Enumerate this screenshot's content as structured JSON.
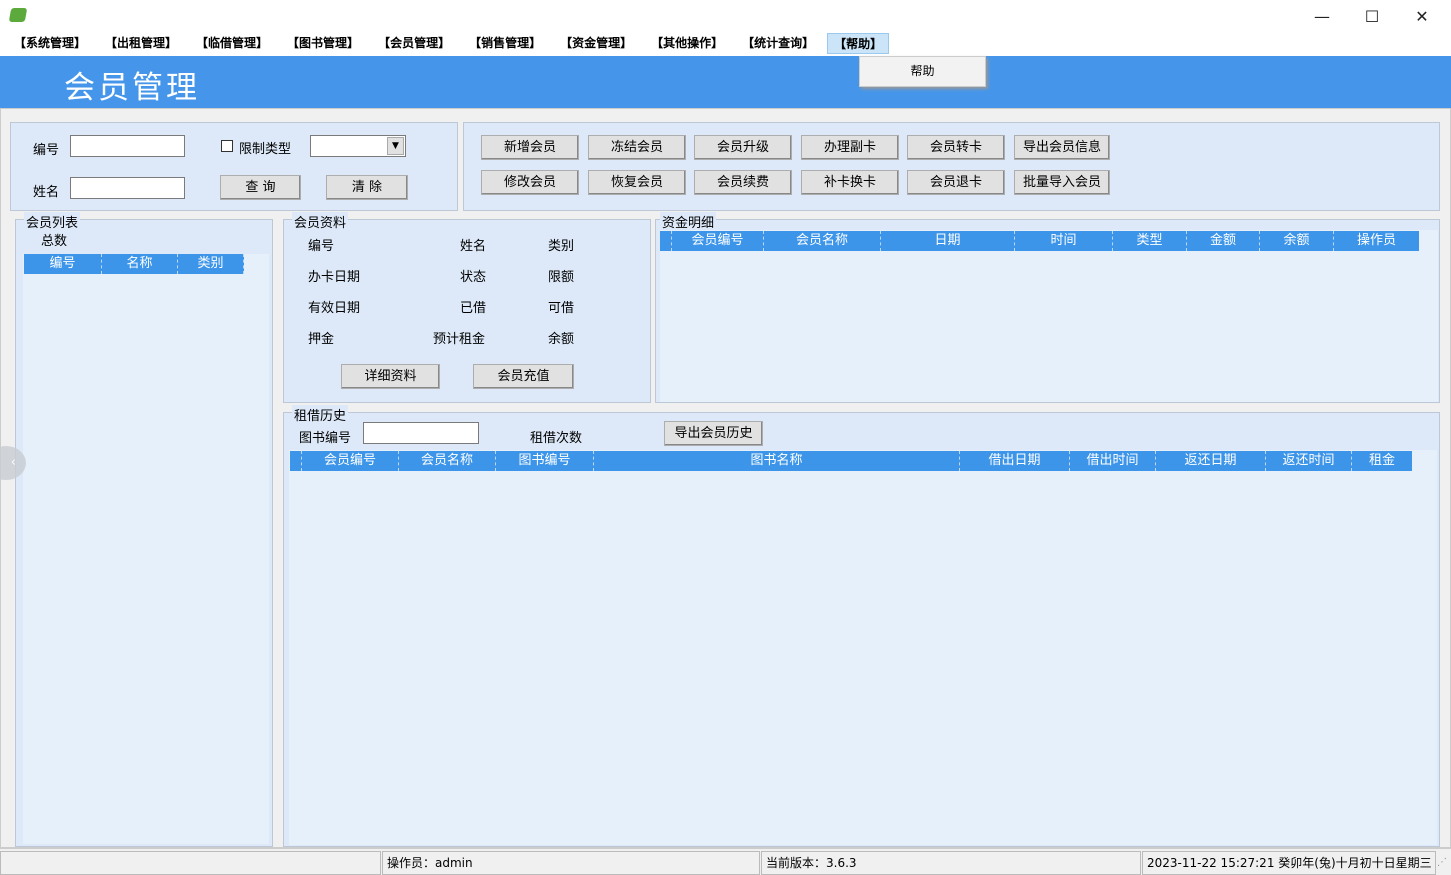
{
  "window": {
    "minimize": "—",
    "maximize": "☐",
    "close": "✕"
  },
  "menu": [
    "【系统管理】",
    "【出租管理】",
    "【临借管理】",
    "【图书管理】",
    "【会员管理】",
    "【销售管理】",
    "【资金管理】",
    "【其他操作】",
    "【统计查询】",
    "【帮助】"
  ],
  "dropdown": {
    "item": "帮助"
  },
  "header": {
    "title": "会员管理"
  },
  "search": {
    "id_label": "编号",
    "name_label": "姓名",
    "id_value": "",
    "name_value": "",
    "limit_type_label": "限制类型",
    "limit_type_checked": false,
    "type_value": "",
    "query": "查 询",
    "clear": "清 除"
  },
  "actions": [
    "新增会员",
    "冻结会员",
    "会员升级",
    "办理副卡",
    "会员转卡",
    "导出会员信息",
    "修改会员",
    "恢复会员",
    "会员续费",
    "补卡换卡",
    "会员退卡",
    "批量导入会员"
  ],
  "member_list": {
    "title": "会员列表",
    "total_label": "总数",
    "columns": [
      "编号",
      "名称",
      "类别"
    ]
  },
  "member_info": {
    "title": "会员资料",
    "fields": [
      "编号",
      "姓名",
      "类别",
      "办卡日期",
      "状态",
      "限额",
      "有效日期",
      "已借",
      "可借",
      "押金",
      "预计租金",
      "余额"
    ],
    "detail": "详细资料",
    "recharge": "会员充值"
  },
  "funds": {
    "title": "资金明细",
    "columns": [
      "会员编号",
      "会员名称",
      "日期",
      "时间",
      "类型",
      "金额",
      "余额",
      "操作员"
    ]
  },
  "history": {
    "title": "租借历史",
    "book_id_label": "图书编号",
    "book_id_value": "",
    "count_label": "租借次数",
    "export": "导出会员历史",
    "columns": [
      "会员编号",
      "会员名称",
      "图书编号",
      "图书名称",
      "借出日期",
      "借出时间",
      "返还日期",
      "返还时间",
      "租金"
    ]
  },
  "status": {
    "operator": "操作员：admin",
    "version": "当前版本：3.6.3",
    "datetime": "2023-11-22 15:27:21 癸卯年(兔)十月初十日星期三"
  }
}
